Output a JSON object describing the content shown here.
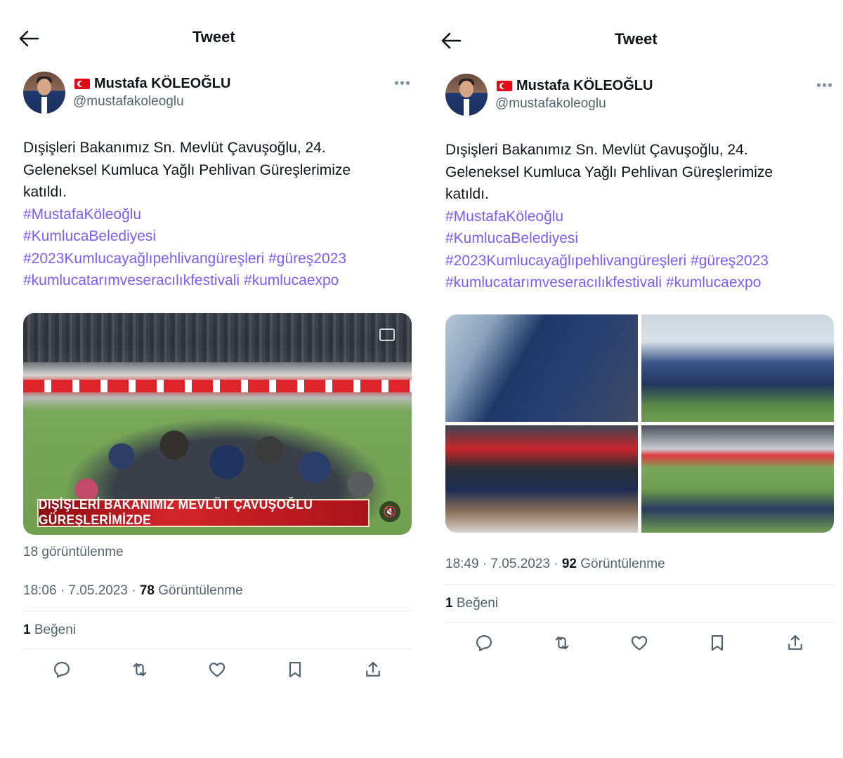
{
  "header": {
    "title": "Tweet"
  },
  "author": {
    "name": "Mustafa KÖLEOĞLU",
    "handle": "@mustafakoleoglu"
  },
  "tweet": {
    "lines": [
      "Dışişleri Bakanımız Sn. Mevlüt Çavuşoğlu, 24.",
      "Geleneksel Kumluca Yağlı Pehlivan Güreşlerimize",
      "katıldı."
    ],
    "hashtags": {
      "h1": "#MustafaKöleoğlu",
      "h2": "#KumlucaBelediyesi",
      "h3": "#2023Kumlucayağlıpehlivangüreşleri",
      "h4": "#güreş2023",
      "h5": "#kumlucatarımveseracılıkfestivali",
      "h6": "#kumlucaexpo"
    }
  },
  "left": {
    "video_banner": "DIŞİŞLERİ BAKANIMIZ MEVLÜT ÇAVUŞOĞLU GÜREŞLERİMİZDE",
    "video_views": "18 görüntülenme",
    "time": "18:06 · 7.05.2023 · ",
    "views_count": "78",
    "views_label": "Görüntülenme",
    "likes_count": "1",
    "likes_label": "Beğeni"
  },
  "right": {
    "time": "18:49 · 7.05.2023 · ",
    "views_count": "92",
    "views_label": "Görüntülenme",
    "likes_count": "1",
    "likes_label": "Beğeni"
  },
  "icons": {
    "back": "arrow-left-icon",
    "more": "more-horizontal-icon",
    "reply": "reply-icon",
    "retweet": "retweet-icon",
    "like": "heart-icon",
    "bookmark": "bookmark-icon",
    "share": "share-icon"
  },
  "colors": {
    "hashtag": "#7b5cff",
    "muted": "#536471",
    "text": "#0f1419"
  }
}
